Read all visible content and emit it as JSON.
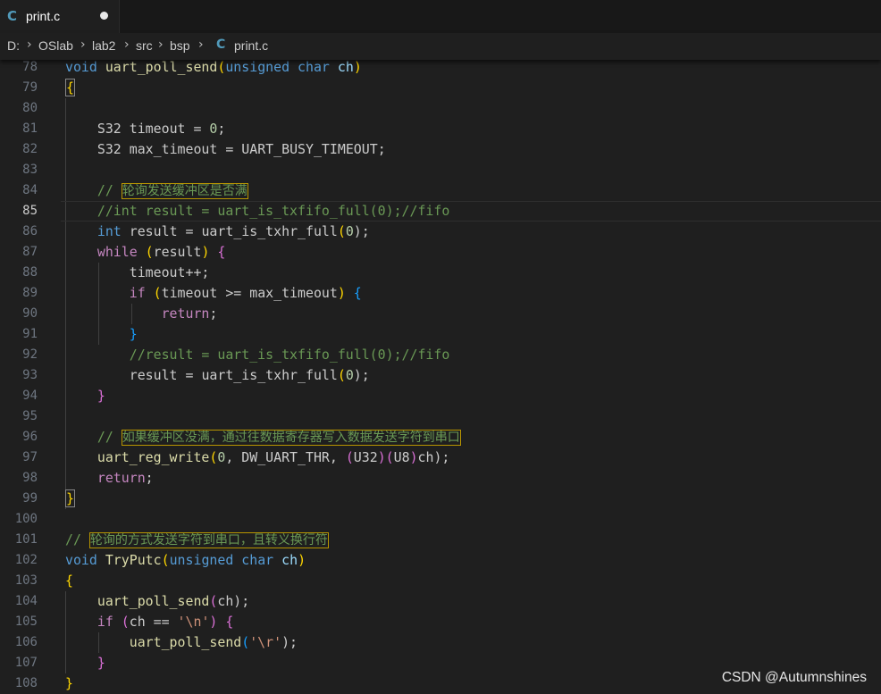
{
  "tab": {
    "icon": "c-language-icon",
    "filename": "print.c"
  },
  "breadcrumb": {
    "items": [
      "D:",
      "OSlab",
      "lab2",
      "src",
      "bsp",
      "print.c"
    ]
  },
  "editor": {
    "current_line": "85",
    "lines": [
      {
        "n": "78",
        "code": [
          "void",
          "uart_poll_send",
          "(",
          "unsigned",
          "char",
          "ch",
          ")"
        ]
      },
      {
        "n": "79",
        "code": [
          "{"
        ]
      },
      {
        "n": "80",
        "code": []
      },
      {
        "n": "81",
        "code": [
          "S32",
          "timeout",
          "=",
          "0",
          ";"
        ]
      },
      {
        "n": "82",
        "code": [
          "S32",
          "max_timeout",
          "=",
          "UART_BUSY_TIMEOUT",
          ";"
        ]
      },
      {
        "n": "83",
        "code": []
      },
      {
        "n": "84",
        "code": [
          "// ",
          "轮询发送缓冲区是否满"
        ]
      },
      {
        "n": "85",
        "code": [
          "//int result = uart_is_txfifo_full(0);//fifo"
        ]
      },
      {
        "n": "86",
        "code": [
          "int",
          "result",
          "=",
          "uart_is_txhr_full",
          "(",
          "0",
          ");"
        ]
      },
      {
        "n": "87",
        "code": [
          "while",
          "(",
          "result",
          ")",
          "{"
        ]
      },
      {
        "n": "88",
        "code": [
          "timeout++;"
        ]
      },
      {
        "n": "89",
        "code": [
          "if",
          "(",
          "timeout >= max_timeout",
          ")",
          "{"
        ]
      },
      {
        "n": "90",
        "code": [
          "return",
          ";"
        ]
      },
      {
        "n": "91",
        "code": [
          "}"
        ]
      },
      {
        "n": "92",
        "code": [
          "//result = uart_is_txfifo_full(0);//fifo"
        ]
      },
      {
        "n": "93",
        "code": [
          "result",
          "=",
          "uart_is_txhr_full",
          "(",
          "0",
          ");"
        ]
      },
      {
        "n": "94",
        "code": [
          "}"
        ]
      },
      {
        "n": "95",
        "code": []
      },
      {
        "n": "96",
        "code": [
          "// ",
          "如果缓冲区没满，通过往数据寄存器写入数据发送字符到串口"
        ]
      },
      {
        "n": "97",
        "code": [
          "uart_reg_write",
          "(",
          "0",
          ", DW_UART_THR, ",
          "(",
          "U32",
          ")",
          "(",
          "U8",
          ")",
          "ch",
          ");"
        ]
      },
      {
        "n": "98",
        "code": [
          "return",
          ";"
        ]
      },
      {
        "n": "99",
        "code": [
          "}"
        ]
      },
      {
        "n": "100",
        "code": []
      },
      {
        "n": "101",
        "code": [
          "// ",
          "轮询的方式发送字符到串口，且转义换行符"
        ]
      },
      {
        "n": "102",
        "code": [
          "void",
          "TryPutc",
          "(",
          "unsigned",
          "char",
          "ch",
          ")"
        ]
      },
      {
        "n": "103",
        "code": [
          "{"
        ]
      },
      {
        "n": "104",
        "code": [
          "uart_poll_send",
          "(",
          "ch",
          ");"
        ]
      },
      {
        "n": "105",
        "code": [
          "if",
          "(",
          "ch ==",
          "'\\n'",
          ")",
          "{"
        ]
      },
      {
        "n": "106",
        "code": [
          "uart_poll_send",
          "(",
          "'\\r'",
          ");"
        ]
      },
      {
        "n": "107",
        "code": [
          "}"
        ]
      },
      {
        "n": "108",
        "code": [
          "}"
        ]
      }
    ]
  },
  "watermark": "CSDN @Autumnshines",
  "colors": {
    "background": "#1f1f1f",
    "keyword": "#569cd6",
    "control": "#c586c0",
    "function": "#dcdcaa",
    "variable": "#9cdcfe",
    "number": "#b5cea8",
    "string": "#ce9178",
    "comment": "#6a9955"
  }
}
